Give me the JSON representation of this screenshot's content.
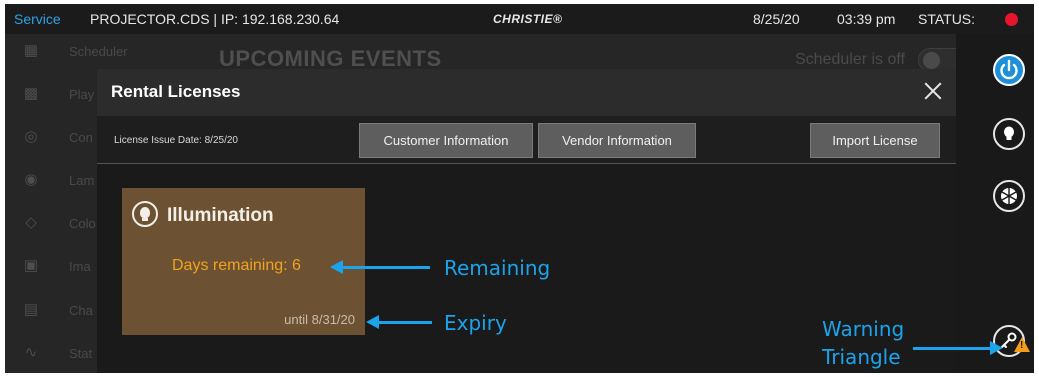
{
  "topbar": {
    "mode": "Service",
    "device": "PROJECTOR.CDS | IP: 192.168.230.64",
    "brand": "CHRISTIE®",
    "date": "8/25/20",
    "time": "03:39 pm",
    "status_label": "STATUS:",
    "status_color": "#e8142c"
  },
  "background": {
    "title": "UPCOMING EVENTS",
    "scheduler_state": "Scheduler is off",
    "nav_items": [
      {
        "label": "Scheduler",
        "icon": "scheduler-icon"
      },
      {
        "label": "Play",
        "icon": "playback-icon"
      },
      {
        "label": "Con",
        "icon": "content-icon"
      },
      {
        "label": "Lam",
        "icon": "lamp-icon"
      },
      {
        "label": "Colo",
        "icon": "color-icon"
      },
      {
        "label": "Ima",
        "icon": "image-icon"
      },
      {
        "label": "Cha",
        "icon": "channel-icon"
      },
      {
        "label": "Stat",
        "icon": "status-icon"
      }
    ]
  },
  "modal": {
    "title": "Rental Licenses",
    "issue_date": "License Issue Date: 8/25/20",
    "buttons": {
      "customer": "Customer Information",
      "vendor": "Vendor Information",
      "import": "Import License"
    },
    "card": {
      "title": "Illumination",
      "days_remaining": "Days remaining: 6",
      "until": "until 8/31/20",
      "color": "#6c5233",
      "accent": "#f3a21f"
    }
  },
  "annotations": {
    "remaining": "Remaining",
    "expiry": "Expiry",
    "warning_line1": "Warning",
    "warning_line2": "Triangle",
    "color": "#1ba3ec"
  },
  "rail": {
    "icons": [
      "power-icon",
      "lamp-icon",
      "shutter-icon",
      "license-key-icon"
    ],
    "accent": "#1e8fd9",
    "warning_color": "#f39b1b"
  }
}
